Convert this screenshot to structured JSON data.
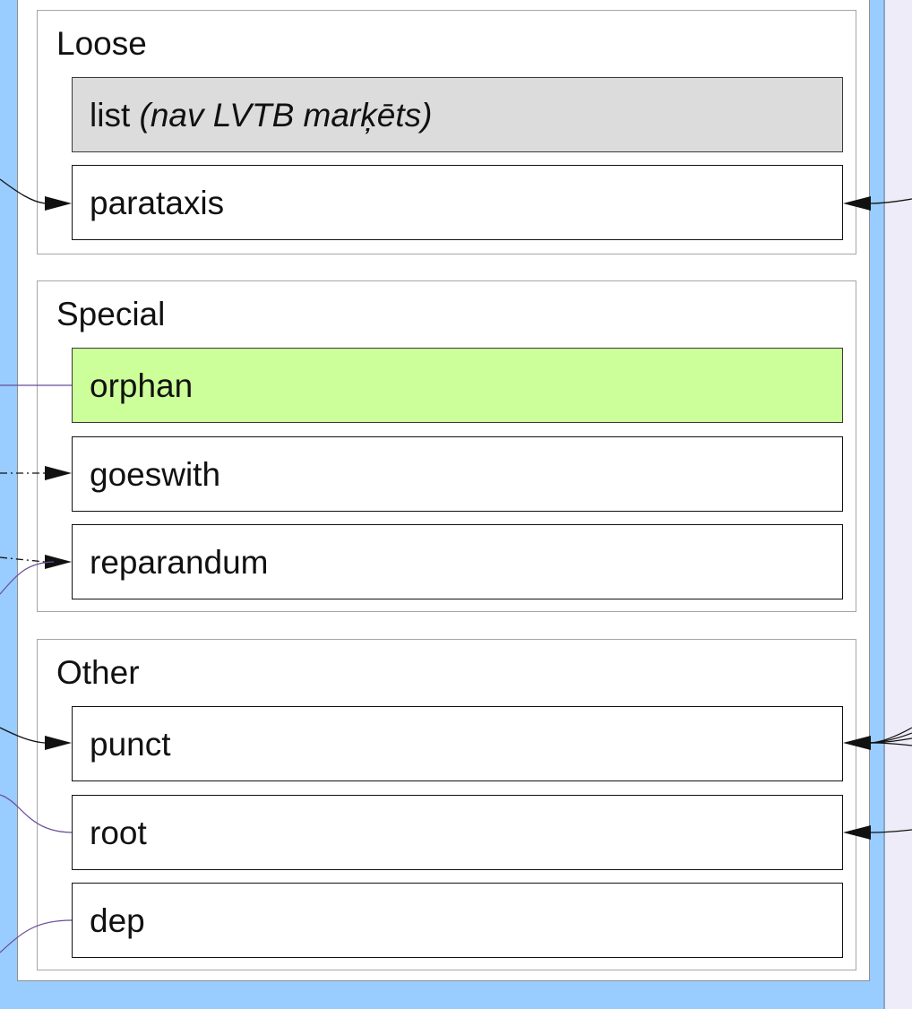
{
  "groups": {
    "loose": {
      "title": "Loose",
      "list": {
        "label": "list",
        "note": "(nav LVTB marķēts)"
      },
      "parataxis": {
        "label": "parataxis"
      }
    },
    "special": {
      "title": "Special",
      "orphan": {
        "label": "orphan"
      },
      "goeswith": {
        "label": "goeswith"
      },
      "reparandum": {
        "label": "reparandum"
      }
    },
    "other": {
      "title": "Other",
      "punct": {
        "label": "punct"
      },
      "root": {
        "label": "root"
      },
      "dep": {
        "label": "dep"
      }
    }
  },
  "colors": {
    "background_panel": "#99ccff",
    "right_background": "#eeecf8",
    "gray_box": "#dcdcdc",
    "green_box": "#ccff99",
    "purple_line": "#6a4c9c",
    "arrow": "#111111"
  }
}
